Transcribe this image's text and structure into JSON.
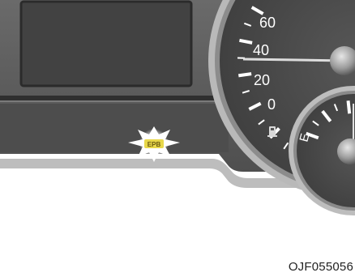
{
  "speedometer": {
    "tick_labels": [
      "60",
      "40",
      "20",
      "0"
    ],
    "needle_value": 40
  },
  "fuel_gauge": {
    "empty_label": "E"
  },
  "indicator": {
    "label": "EPB",
    "state": "illuminated",
    "color": "#e8d84a"
  },
  "colors": {
    "panel": "#5f5f5f",
    "panel_dark": "#3b3b3b",
    "bezel": "#c9c9c9",
    "gauge_face": "#4a4a4a",
    "graphics": "#ffffff"
  },
  "caption": "OJF055056"
}
